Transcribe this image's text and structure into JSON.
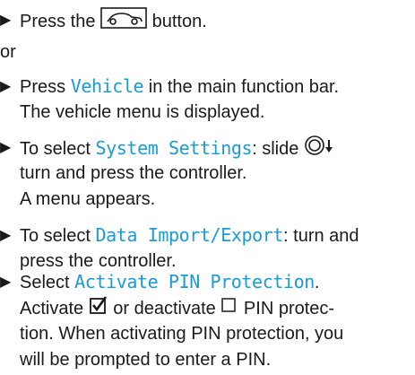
{
  "step1": {
    "pre": "Press the",
    "post": "button.",
    "icon": "vehicle-icon"
  },
  "or_text": "or",
  "step2": {
    "pre": "Press",
    "term": "Vehicle",
    "post": "in the main function bar.",
    "line2": "The vehicle menu is displayed."
  },
  "step3": {
    "pre": "To select",
    "term": "System Settings",
    "post": ": slide",
    "controller_icon": "controller-slide-down-icon",
    "line2": "turn and press the controller.",
    "line3": "A menu appears."
  },
  "step4": {
    "pre": "To select",
    "term": "Data Import/Export",
    "post": ": turn and",
    "line2": "press the controller."
  },
  "step5": {
    "pre": "Select",
    "term": "Activate PIN Protection",
    "post": ".",
    "line2_pre": "Activate",
    "line2_mid": "or deactivate",
    "line2_post": "PIN protec-",
    "line3": "tion. When activating PIN protection, you",
    "line4": "will be prompted to enter a PIN.",
    "checked_icon": "checkbox-checked-icon",
    "unchecked_icon": "checkbox-unchecked-icon"
  },
  "colors": {
    "accent": "#1a9ad6",
    "text": "#1a1a1a"
  }
}
